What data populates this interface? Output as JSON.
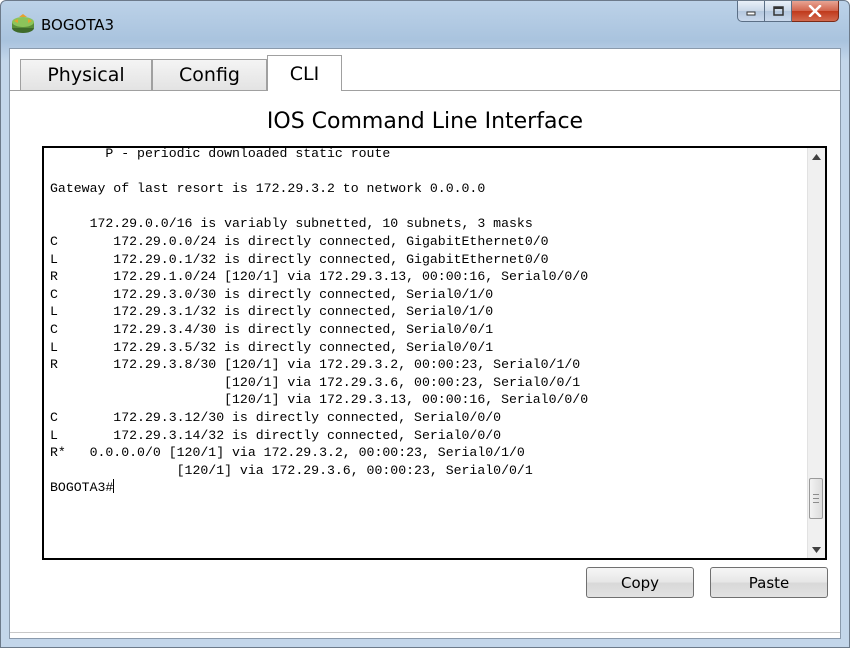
{
  "window": {
    "title": "BOGOTA3",
    "controls": {
      "minimize": "minimize-icon",
      "maximize": "maximize-icon",
      "close": "close-icon"
    }
  },
  "tabs": [
    {
      "label": "Physical",
      "active": false
    },
    {
      "label": "Config",
      "active": false
    },
    {
      "label": "CLI",
      "active": true
    }
  ],
  "pane": {
    "title": "IOS Command Line Interface"
  },
  "terminal": {
    "lines": [
      "       P - periodic downloaded static route",
      "",
      "Gateway of last resort is 172.29.3.2 to network 0.0.0.0",
      "",
      "     172.29.0.0/16 is variably subnetted, 10 subnets, 3 masks",
      "C       172.29.0.0/24 is directly connected, GigabitEthernet0/0",
      "L       172.29.0.1/32 is directly connected, GigabitEthernet0/0",
      "R       172.29.1.0/24 [120/1] via 172.29.3.13, 00:00:16, Serial0/0/0",
      "C       172.29.3.0/30 is directly connected, Serial0/1/0",
      "L       172.29.3.1/32 is directly connected, Serial0/1/0",
      "C       172.29.3.4/30 is directly connected, Serial0/0/1",
      "L       172.29.3.5/32 is directly connected, Serial0/0/1",
      "R       172.29.3.8/30 [120/1] via 172.29.3.2, 00:00:23, Serial0/1/0",
      "                      [120/1] via 172.29.3.6, 00:00:23, Serial0/0/1",
      "                      [120/1] via 172.29.3.13, 00:00:16, Serial0/0/0",
      "C       172.29.3.12/30 is directly connected, Serial0/0/0",
      "L       172.29.3.14/32 is directly connected, Serial0/0/0",
      "R*   0.0.0.0/0 [120/1] via 172.29.3.2, 00:00:23, Serial0/1/0",
      "                [120/1] via 172.29.3.6, 00:00:23, Serial0/0/1"
    ],
    "prompt": "BOGOTA3#"
  },
  "buttons": {
    "copy": "Copy",
    "paste": "Paste"
  },
  "colors": {
    "close_button": "#c9462a",
    "titlebar": "#b6cde6",
    "terminal_border": "#000000"
  }
}
